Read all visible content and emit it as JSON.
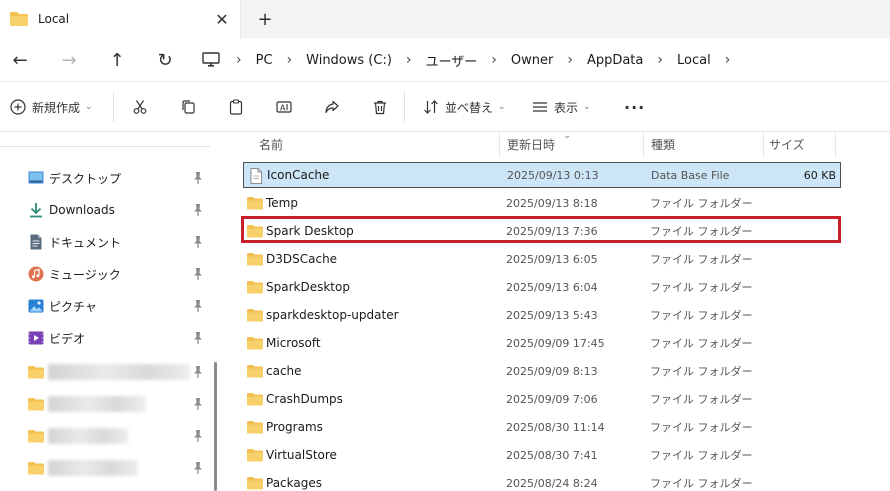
{
  "tab": {
    "title": "Local",
    "close": "✕",
    "new_tab": "+"
  },
  "nav": {
    "back": "←",
    "forward": "→",
    "up": "↑",
    "refresh": "↻"
  },
  "breadcrumbs": [
    "PC",
    "Windows (C:)",
    "ユーザー",
    "Owner",
    "AppData",
    "Local"
  ],
  "toolbar": {
    "new_label": "新規作成",
    "sort_label": "並べ替え",
    "view_label": "表示",
    "more": "···"
  },
  "sidebar": {
    "items": [
      {
        "label": "デスクトップ",
        "icon": "desktop-icon"
      },
      {
        "label": "Downloads",
        "icon": "download-icon"
      },
      {
        "label": "ドキュメント",
        "icon": "documents-icon"
      },
      {
        "label": "ミュージック",
        "icon": "music-icon"
      },
      {
        "label": "ピクチャ",
        "icon": "pictures-icon"
      },
      {
        "label": "ビデオ",
        "icon": "videos-icon"
      }
    ]
  },
  "columns": {
    "name": "名前",
    "date": "更新日時",
    "type": "種類",
    "size": "サイズ"
  },
  "files": [
    {
      "name": "IconCache",
      "date": "2025/09/13 0:13",
      "type": "Data Base File",
      "size": "60 KB",
      "kind": "file"
    },
    {
      "name": "Temp",
      "date": "2025/09/13 8:18",
      "type": "ファイル フォルダー",
      "size": "",
      "kind": "folder"
    },
    {
      "name": "Spark Desktop",
      "date": "2025/09/13 7:36",
      "type": "ファイル フォルダー",
      "size": "",
      "kind": "folder"
    },
    {
      "name": "D3DSCache",
      "date": "2025/09/13 6:05",
      "type": "ファイル フォルダー",
      "size": "",
      "kind": "folder"
    },
    {
      "name": "SparkDesktop",
      "date": "2025/09/13 6:04",
      "type": "ファイル フォルダー",
      "size": "",
      "kind": "folder"
    },
    {
      "name": "sparkdesktop-updater",
      "date": "2025/09/13 5:43",
      "type": "ファイル フォルダー",
      "size": "",
      "kind": "folder"
    },
    {
      "name": "Microsoft",
      "date": "2025/09/09 17:45",
      "type": "ファイル フォルダー",
      "size": "",
      "kind": "folder"
    },
    {
      "name": "cache",
      "date": "2025/09/09 8:13",
      "type": "ファイル フォルダー",
      "size": "",
      "kind": "folder"
    },
    {
      "name": "CrashDumps",
      "date": "2025/09/09 7:06",
      "type": "ファイル フォルダー",
      "size": "",
      "kind": "folder"
    },
    {
      "name": "Programs",
      "date": "2025/08/30 11:14",
      "type": "ファイル フォルダー",
      "size": "",
      "kind": "folder"
    },
    {
      "name": "VirtualStore",
      "date": "2025/08/30 7:41",
      "type": "ファイル フォルダー",
      "size": "",
      "kind": "folder"
    },
    {
      "name": "Packages",
      "date": "2025/08/24 8:24",
      "type": "ファイル フォルダー",
      "size": "",
      "kind": "folder"
    }
  ],
  "colors": {
    "folder": "#f2c14e",
    "selected_bg": "#cde6f7",
    "highlight": "#c8202a"
  }
}
